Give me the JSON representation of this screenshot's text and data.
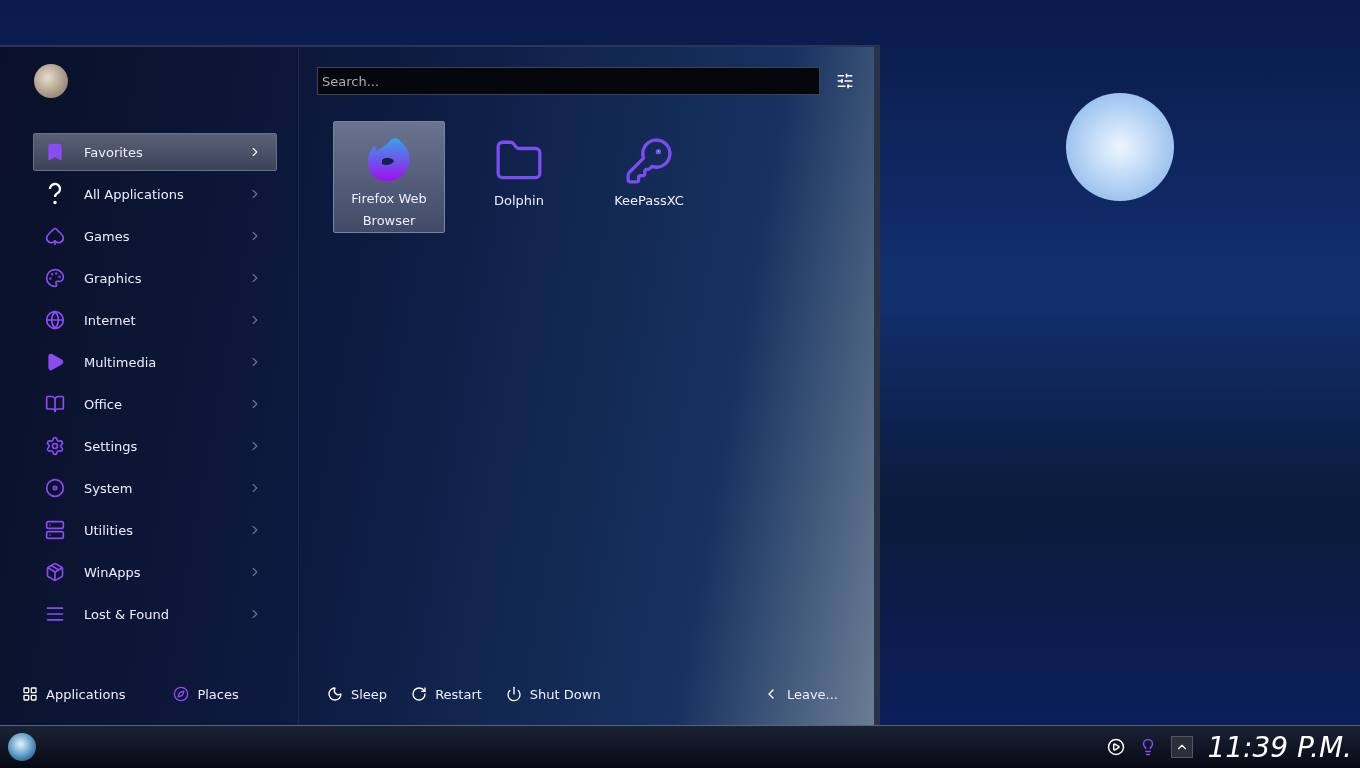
{
  "search": {
    "placeholder": "Search..."
  },
  "categories": [
    {
      "label": "Favorites",
      "selected": true
    },
    {
      "label": "All Applications",
      "selected": false
    },
    {
      "label": "Games",
      "selected": false
    },
    {
      "label": "Graphics",
      "selected": false
    },
    {
      "label": "Internet",
      "selected": false
    },
    {
      "label": "Multimedia",
      "selected": false
    },
    {
      "label": "Office",
      "selected": false
    },
    {
      "label": "Settings",
      "selected": false
    },
    {
      "label": "System",
      "selected": false
    },
    {
      "label": "Utilities",
      "selected": false
    },
    {
      "label": "WinApps",
      "selected": false
    },
    {
      "label": "Lost & Found",
      "selected": false
    }
  ],
  "apps": [
    {
      "label": "Firefox Web Browser",
      "selected": true
    },
    {
      "label": "Dolphin",
      "selected": false
    },
    {
      "label": "KeePassXC",
      "selected": false
    }
  ],
  "footer_tabs": [
    {
      "label": "Applications"
    },
    {
      "label": "Places"
    }
  ],
  "power_actions": [
    {
      "label": "Sleep"
    },
    {
      "label": "Restart"
    },
    {
      "label": "Shut Down"
    }
  ],
  "leave": {
    "label": "Leave..."
  },
  "taskbar": {
    "clock": "11:39 P.M."
  }
}
